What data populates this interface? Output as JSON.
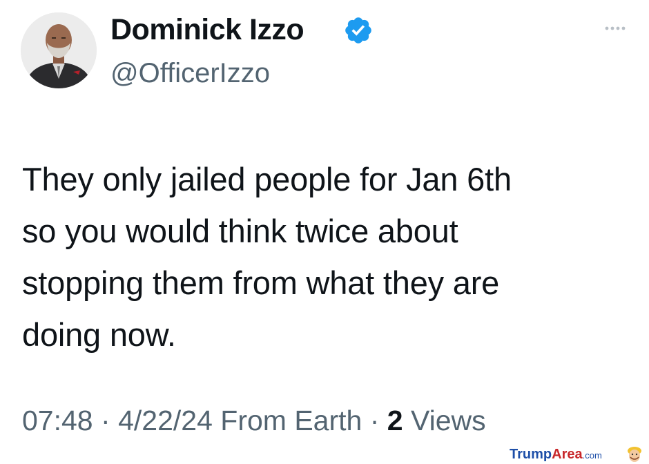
{
  "tweet": {
    "display_name": "Dominick Izzo",
    "handle": "@OfficerIzzo",
    "verified_icon": "verified-badge-icon",
    "more_icon": "more-options-icon",
    "text": "They only jailed people for Jan 6th\nso you would think twice about\nstopping them from what they are\ndoing now.",
    "time": "07:48",
    "separator": "·",
    "date": "4/22/24",
    "source": "From Earth",
    "views_count": "2",
    "views_label": "Views"
  },
  "watermark": {
    "part1": "Trump",
    "part2": "Area",
    "part3": ".com"
  },
  "colors": {
    "text": "#0f1419",
    "secondary": "#536471",
    "verified": "#1d9bf0"
  }
}
